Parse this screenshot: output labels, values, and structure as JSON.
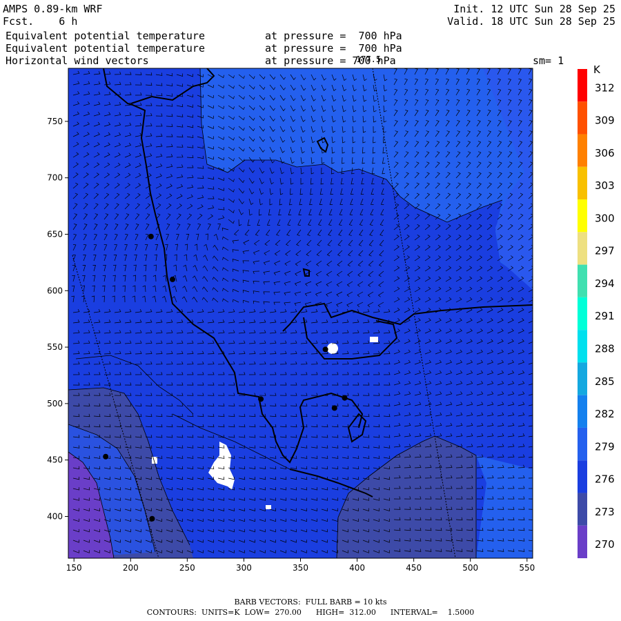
{
  "header": {
    "model": "AMPS 0.89-km WRF",
    "forecast": "Fcst.    6 h",
    "init": "Init. 12 UTC Sun 28 Sep 25",
    "valid": "Valid. 18 UTC Sun 28 Sep 25",
    "line1_field": "Equivalent potential temperature",
    "line1_level": "at pressure =  700 hPa",
    "line2_field": "Equivalent potential temperature",
    "line2_level": "at pressure =  700 hPa",
    "line3_field": "Horizontal wind vectors",
    "line3_level": "at pressure = 700 hPa",
    "overlap_label": "177.5",
    "smoothing": "sm= 1"
  },
  "footer": {
    "barb": "BARB VECTORS:  FULL BARB = 10 kts",
    "contours": "CONTOURS:  UNITS=K  LOW=  270.00      HIGH=  312.00      INTERVAL=    1.5000"
  },
  "colors": {
    "bg_main": "#1a3ee0",
    "bg_light": "#2460ee",
    "bg_dark": "#3a4ec8",
    "bg_navy": "#3d4aa8",
    "bg_purple": "#6a3ec8"
  },
  "chart_data": {
    "type": "heatmap",
    "xlim": [
      145,
      555
    ],
    "ylim": [
      363,
      797
    ],
    "x_ticks": [
      150,
      200,
      250,
      300,
      350,
      400,
      450,
      500,
      550
    ],
    "y_ticks": [
      400,
      450,
      500,
      550,
      600,
      650,
      700,
      750
    ],
    "colorbar": {
      "unit": "K",
      "ticks": [
        270,
        273,
        276,
        279,
        282,
        285,
        288,
        291,
        294,
        297,
        300,
        303,
        306,
        309,
        312
      ],
      "colors": [
        "#6a3ec8",
        "#3d4aa8",
        "#1a3ee0",
        "#2460ee",
        "#1480ee",
        "#14a8e0",
        "#00e0ee",
        "#00ffd8",
        "#40e0b0",
        "#eee080",
        "#ffff00",
        "#f8c000",
        "#ff8000",
        "#ff5000",
        "#ff0000"
      ]
    },
    "stations": [
      [
        218,
        648
      ],
      [
        237,
        610
      ],
      [
        315,
        504
      ],
      [
        389,
        505
      ],
      [
        380,
        496
      ],
      [
        178,
        453
      ],
      [
        219,
        398
      ],
      [
        372,
        548
      ]
    ]
  }
}
